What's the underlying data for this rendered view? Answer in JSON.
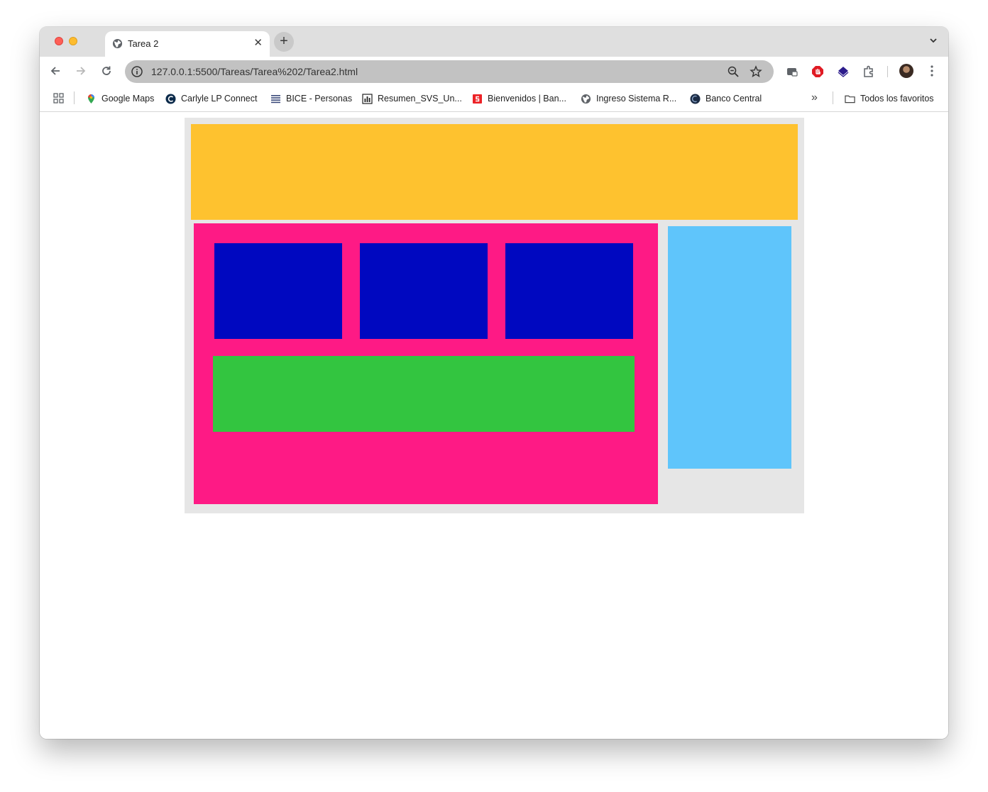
{
  "tab": {
    "title": "Tarea 2",
    "close": "✕",
    "new_tab": "+"
  },
  "omnibox": {
    "url": "127.0.0.1:5500/Tareas/Tarea%202/Tarea2.html"
  },
  "bookmarks": [
    {
      "label": "Google Maps",
      "icon": "google-maps-icon"
    },
    {
      "label": "Carlyle LP Connect",
      "icon": "carlyle-icon"
    },
    {
      "label": "BICE - Personas",
      "icon": "bice-icon"
    },
    {
      "label": "Resumen_SVS_Un...",
      "icon": "chart-icon"
    },
    {
      "label": "Bienvenidos | Ban...",
      "icon": "santander-icon"
    },
    {
      "label": "Ingreso Sistema R...",
      "icon": "globe-icon"
    },
    {
      "label": "Banco Central",
      "icon": "banco-central-icon"
    }
  ],
  "bookmarks_overflow": "»",
  "all_bookmarks": "Todos los favoritos",
  "page": {
    "colors": {
      "container": "#e6e6e6",
      "header": "#fec22f",
      "main": "#fe1a85",
      "boxes": "#0008c0",
      "green_block": "#33c540",
      "aside": "#5fc5fb"
    }
  }
}
